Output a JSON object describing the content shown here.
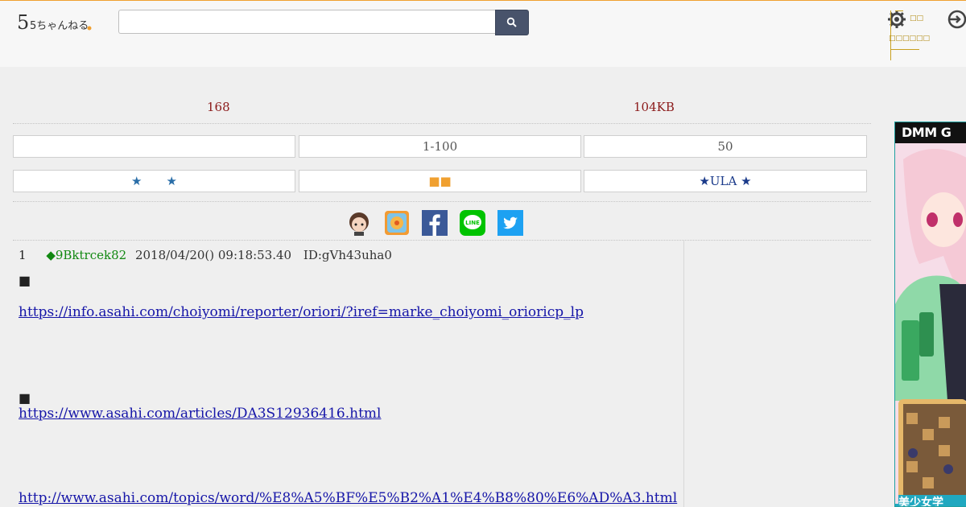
{
  "header": {
    "logo_text": "5ちゃんねる",
    "search": {
      "value": "",
      "placeholder": ""
    },
    "search_icon": "magnifier-icon",
    "settings_icon": "gear-icon",
    "settings_label_1": "□□",
    "settings_label_2": "□□□□□□",
    "login_icon": "login-icon"
  },
  "info": {
    "count": "168",
    "size": "104KB"
  },
  "nav_row1": [
    {
      "label": ""
    },
    {
      "label": "1-100"
    },
    {
      "label": "50"
    }
  ],
  "nav_row2": [
    {
      "label": "★　　★"
    },
    {
      "label": "■■"
    },
    {
      "label": "★ULA ★"
    }
  ],
  "share_icons": [
    "hatena-avatar-icon",
    "pocket-icon",
    "facebook-icon",
    "line-icon",
    "twitter-icon"
  ],
  "post": {
    "number": "1",
    "trip": "◆9Bktrcek82",
    "date": "2018/04/20() 09:18:53.40",
    "id": "ID:gVh43uha0",
    "lines": [
      {
        "type": "text",
        "text": "■"
      },
      {
        "type": "link",
        "text": "https://info.asahi.com/choiyomi/reporter/oriori/?iref=marke_choiyomi_orioricp_lp"
      },
      {
        "type": "text",
        "text": "■"
      },
      {
        "type": "link",
        "text": "https://www.asahi.com/articles/DA3S12936416.html"
      },
      {
        "type": "link",
        "text": "http://www.asahi.com/topics/word/%E8%A5%BF%E5%B2%A1%E4%B8%80%E6%AD%A3.html"
      }
    ]
  },
  "ad": {
    "brand": "DMM G",
    "tagline": "美少女学"
  },
  "colors": {
    "accent": "#f0a030",
    "search_button": "#48536b",
    "link": "#1515a8",
    "trip": "#118811",
    "info": "#8b1a1a"
  }
}
